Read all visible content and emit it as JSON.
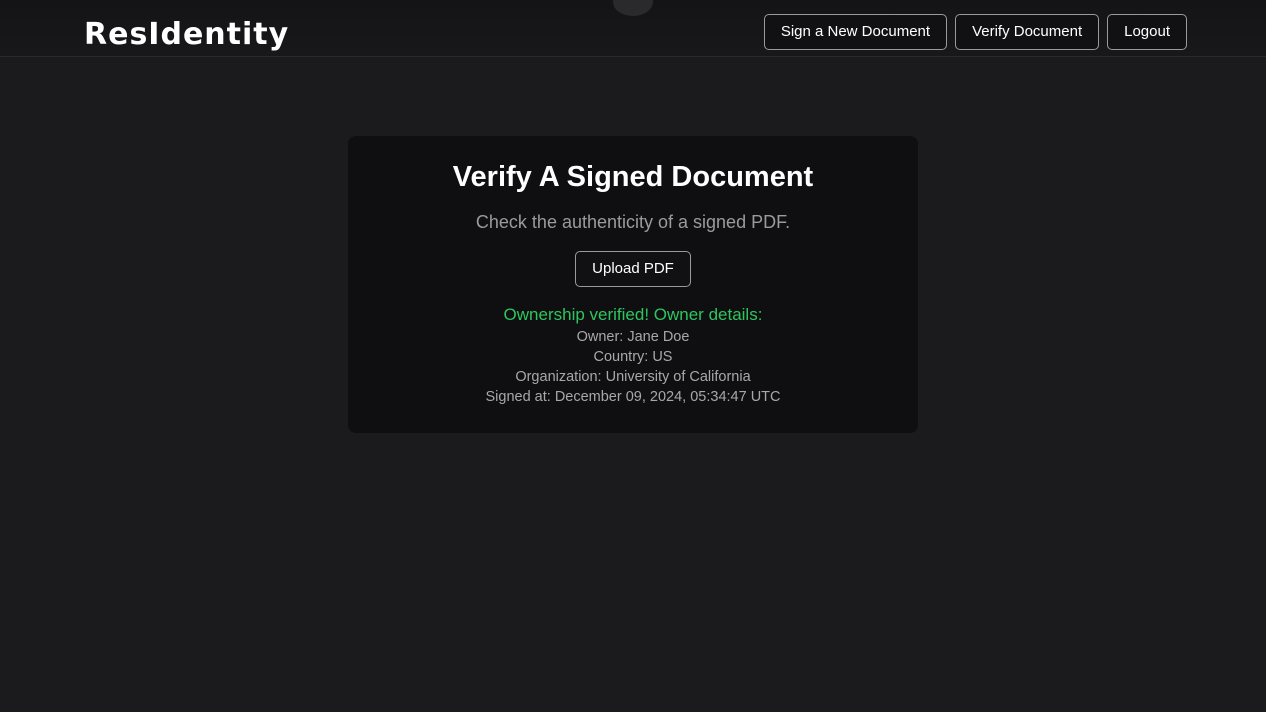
{
  "header": {
    "brand": "ResIdentity",
    "nav": {
      "sign_new": "Sign a New Document",
      "verify": "Verify Document",
      "logout": "Logout"
    }
  },
  "main": {
    "title": "Verify A Signed Document",
    "subtitle": "Check the authenticity of a signed PDF.",
    "upload_label": "Upload PDF",
    "status_message": "Ownership verified! Owner details:",
    "details": {
      "owner": "Owner: Jane Doe",
      "country": "Country: US",
      "organization": "Organization: University of California",
      "signed_at": "Signed at: December 09, 2024, 05:34:47 UTC"
    }
  },
  "colors": {
    "background": "#1b1b1d",
    "card": "#0f0f11",
    "success": "#2ec55e",
    "muted_text": "#a8a8a8"
  }
}
